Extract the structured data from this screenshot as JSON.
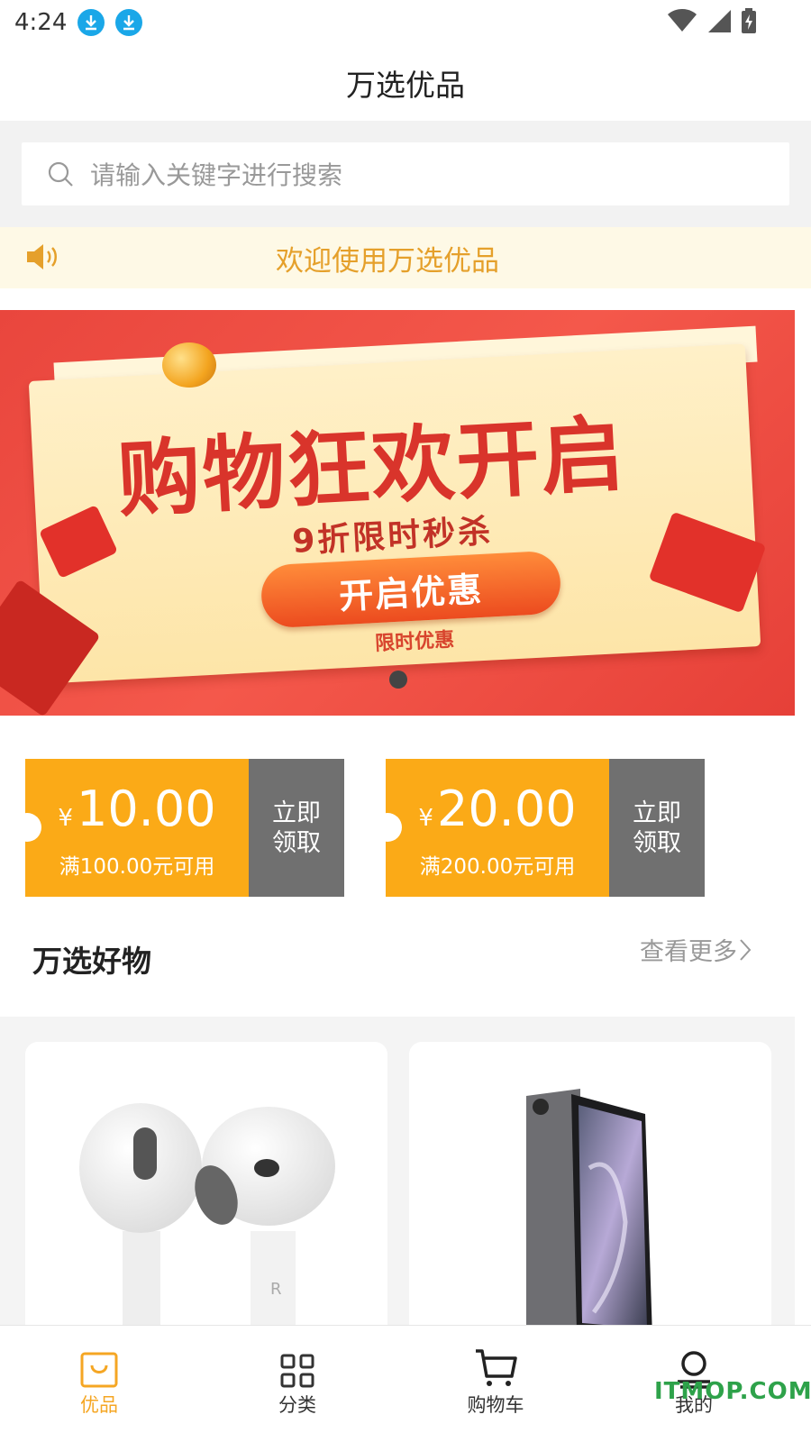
{
  "status_bar": {
    "time": "4:24"
  },
  "header": {
    "title": "万选优品"
  },
  "search": {
    "placeholder": "请输入关键字进行搜索"
  },
  "notice": {
    "text": "欢迎使用万选优品"
  },
  "banner": {
    "title": "购物狂欢开启",
    "subtitle": "9折限时秒杀",
    "button_label": "开启优惠",
    "footnote": "限时优惠"
  },
  "coupons": [
    {
      "currency": "¥",
      "amount": "10.00",
      "condition": "满100.00元可用",
      "action": "立即领取"
    },
    {
      "currency": "¥",
      "amount": "20.00",
      "condition": "满200.00元可用",
      "action": "立即领取"
    }
  ],
  "section": {
    "title": "万选好物",
    "more_label": "查看更多"
  },
  "products": [
    {
      "image": "earbuds"
    },
    {
      "image": "tablet"
    }
  ],
  "tabs": [
    {
      "label": "优品",
      "icon": "bag-icon",
      "active": true
    },
    {
      "label": "分类",
      "icon": "grid-icon",
      "active": false
    },
    {
      "label": "购物车",
      "icon": "cart-icon",
      "active": false
    },
    {
      "label": "我的",
      "icon": "user-icon",
      "active": false
    }
  ],
  "watermark": "ITMOP.COM",
  "colors": {
    "accent": "#F5A623",
    "coupon": "#FBAA17",
    "coupon_action": "#707070",
    "notice_text": "#E5A02B"
  }
}
